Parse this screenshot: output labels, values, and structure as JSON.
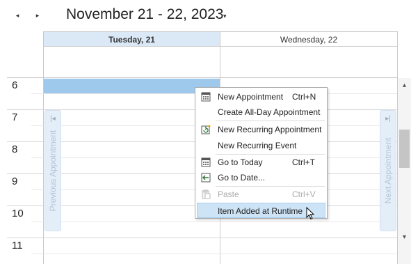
{
  "header": {
    "prev_label": "◂",
    "next_label": "▸",
    "range_title": "November 21 - 22, 2023",
    "range_caret": "▾"
  },
  "days": [
    {
      "label": "Tuesday, 21",
      "selected": true
    },
    {
      "label": "Wednesday, 22",
      "selected": false
    }
  ],
  "hours": [
    "6",
    "7",
    "8",
    "9",
    "10",
    "11"
  ],
  "nav_tabs": {
    "previous": "Previous Appointment",
    "next": "Next Appointment",
    "prev_arrow": "|◂",
    "next_arrow": "▸|"
  },
  "scrollbar": {
    "up": "▴",
    "down": "▾"
  },
  "context_menu": {
    "items": [
      {
        "label": "New Appointment",
        "shortcut": "Ctrl+N",
        "icon": "calendar-grid-icon"
      },
      {
        "label": "Create All-Day Appointment",
        "shortcut": "",
        "icon": ""
      },
      {
        "label": "New Recurring Appointment",
        "shortcut": "",
        "icon": "recurrence-icon"
      },
      {
        "label": "New Recurring Event",
        "shortcut": "",
        "icon": ""
      },
      {
        "label": "Go to Today",
        "shortcut": "Ctrl+T",
        "icon": "calendar-today-icon"
      },
      {
        "label": "Go to Date...",
        "shortcut": "",
        "icon": "goto-date-icon"
      },
      {
        "label": "Paste",
        "shortcut": "Ctrl+V",
        "icon": "paste-icon",
        "disabled": true
      },
      {
        "label": "Item Added at Runtime",
        "shortcut": "",
        "icon": "",
        "hover": true
      }
    ]
  },
  "colors": {
    "selected_slot": "#9ec8ec",
    "selected_header": "#dbe9f7",
    "menu_hover": "#cde4f7"
  }
}
